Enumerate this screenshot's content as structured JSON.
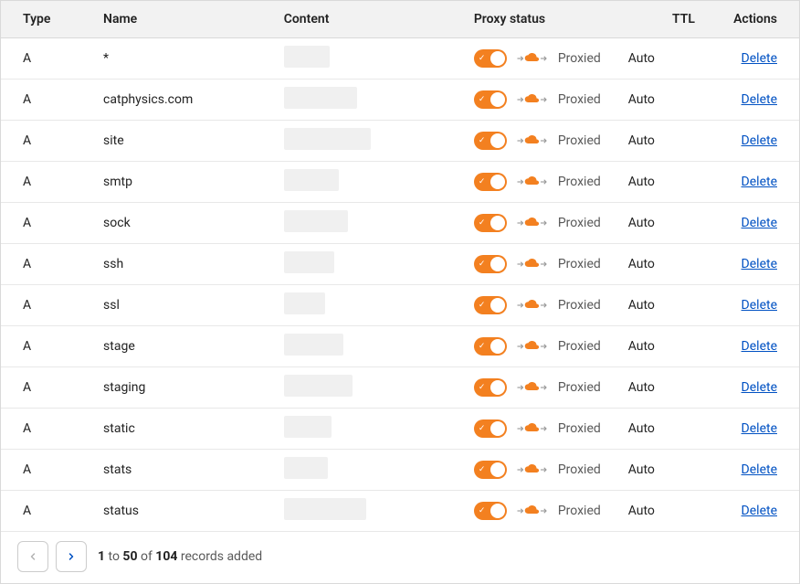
{
  "table": {
    "headers": {
      "type": "Type",
      "name": "Name",
      "content": "Content",
      "proxy": "Proxy status",
      "ttl": "TTL",
      "actions": "Actions"
    },
    "rows": [
      {
        "type": "A",
        "name": "*",
        "content_width": 50,
        "proxied": true,
        "proxy_label": "Proxied",
        "ttl": "Auto",
        "action": "Delete"
      },
      {
        "type": "A",
        "name": "catphysics.com",
        "content_width": 80,
        "proxied": true,
        "proxy_label": "Proxied",
        "ttl": "Auto",
        "action": "Delete"
      },
      {
        "type": "A",
        "name": "site",
        "content_width": 95,
        "proxied": true,
        "proxy_label": "Proxied",
        "ttl": "Auto",
        "action": "Delete"
      },
      {
        "type": "A",
        "name": "smtp",
        "content_width": 60,
        "proxied": true,
        "proxy_label": "Proxied",
        "ttl": "Auto",
        "action": "Delete"
      },
      {
        "type": "A",
        "name": "sock",
        "content_width": 70,
        "proxied": true,
        "proxy_label": "Proxied",
        "ttl": "Auto",
        "action": "Delete"
      },
      {
        "type": "A",
        "name": "ssh",
        "content_width": 55,
        "proxied": true,
        "proxy_label": "Proxied",
        "ttl": "Auto",
        "action": "Delete"
      },
      {
        "type": "A",
        "name": "ssl",
        "content_width": 45,
        "proxied": true,
        "proxy_label": "Proxied",
        "ttl": "Auto",
        "action": "Delete"
      },
      {
        "type": "A",
        "name": "stage",
        "content_width": 65,
        "proxied": true,
        "proxy_label": "Proxied",
        "ttl": "Auto",
        "action": "Delete"
      },
      {
        "type": "A",
        "name": "staging",
        "content_width": 75,
        "proxied": true,
        "proxy_label": "Proxied",
        "ttl": "Auto",
        "action": "Delete"
      },
      {
        "type": "A",
        "name": "static",
        "content_width": 52,
        "proxied": true,
        "proxy_label": "Proxied",
        "ttl": "Auto",
        "action": "Delete"
      },
      {
        "type": "A",
        "name": "stats",
        "content_width": 48,
        "proxied": true,
        "proxy_label": "Proxied",
        "ttl": "Auto",
        "action": "Delete"
      },
      {
        "type": "A",
        "name": "status",
        "content_width": 90,
        "proxied": true,
        "proxy_label": "Proxied",
        "ttl": "Auto",
        "action": "Delete"
      }
    ]
  },
  "pagination": {
    "range_start": "1",
    "range_end": "50",
    "total": "104",
    "range_label_mid": " to ",
    "range_label_of": " of ",
    "suffix": " records added"
  }
}
